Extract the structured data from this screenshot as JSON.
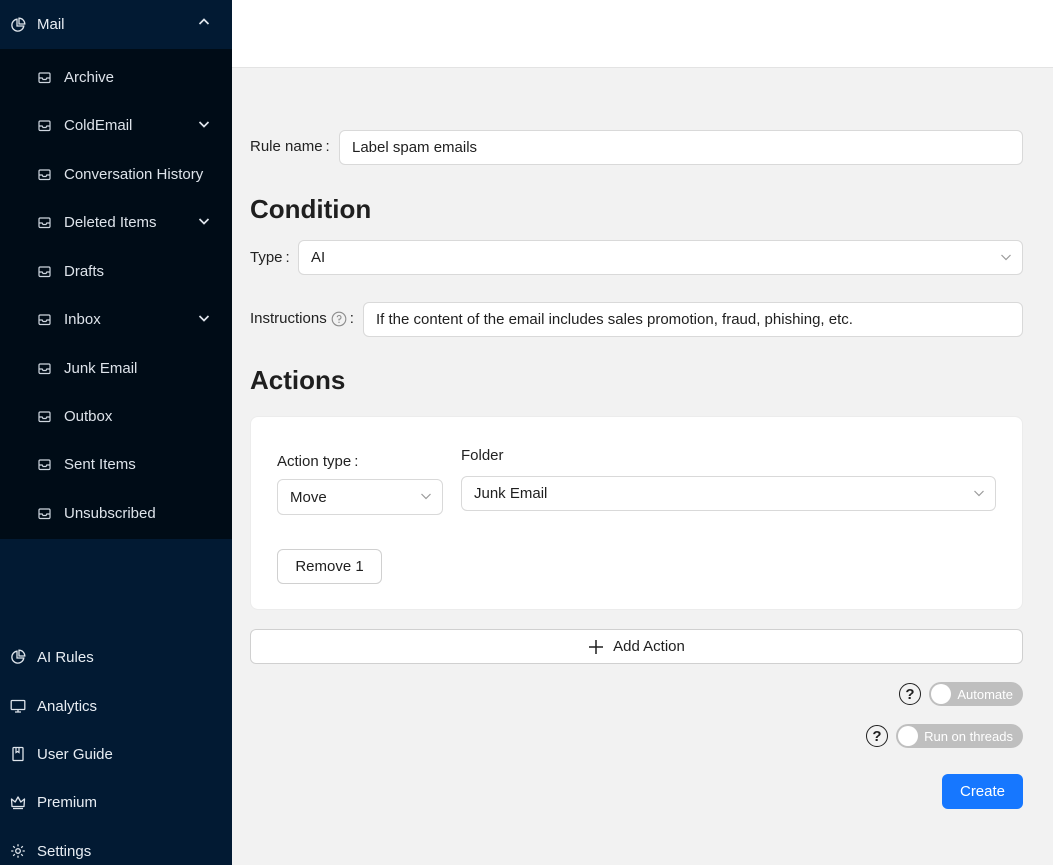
{
  "sidebar": {
    "mail": {
      "label": "Mail",
      "icon": "pie-chart-icon",
      "expanded": true
    },
    "folders": [
      {
        "label": "Archive",
        "has_children": false
      },
      {
        "label": "ColdEmail",
        "has_children": true
      },
      {
        "label": "Conversation History",
        "has_children": false
      },
      {
        "label": "Deleted Items",
        "has_children": true
      },
      {
        "label": "Drafts",
        "has_children": false
      },
      {
        "label": "Inbox",
        "has_children": true
      },
      {
        "label": "Junk Email",
        "has_children": false
      },
      {
        "label": "Outbox",
        "has_children": false
      },
      {
        "label": "Sent Items",
        "has_children": false
      },
      {
        "label": "Unsubscribed",
        "has_children": false
      }
    ],
    "bottom": [
      {
        "label": "AI Rules",
        "icon": "pie-chart-icon"
      },
      {
        "label": "Analytics",
        "icon": "desktop-icon"
      },
      {
        "label": "User Guide",
        "icon": "book-icon"
      },
      {
        "label": "Premium",
        "icon": "crown-icon"
      },
      {
        "label": "Settings",
        "icon": "gear-icon"
      }
    ]
  },
  "form": {
    "rule_name_label": "Rule name",
    "rule_name_value": "Label spam emails",
    "condition_heading": "Condition",
    "type_label": "Type",
    "type_value": "AI",
    "instructions_label": "Instructions",
    "instructions_value": "If the content of the email includes sales promotion, fraud, phishing, etc.",
    "actions_heading": "Actions",
    "action": {
      "type_label": "Action type",
      "type_value": "Move",
      "folder_label": "Folder",
      "folder_value": "Junk Email",
      "remove_label": "Remove 1"
    },
    "add_action_label": "Add Action",
    "automate_label": "Automate",
    "run_on_threads_label": "Run on threads",
    "create_label": "Create"
  },
  "colors": {
    "sidebar_bg": "#021a33",
    "submenu_bg": "#000c17",
    "primary": "#1677ff",
    "toggle_off": "#bfbfbf"
  }
}
